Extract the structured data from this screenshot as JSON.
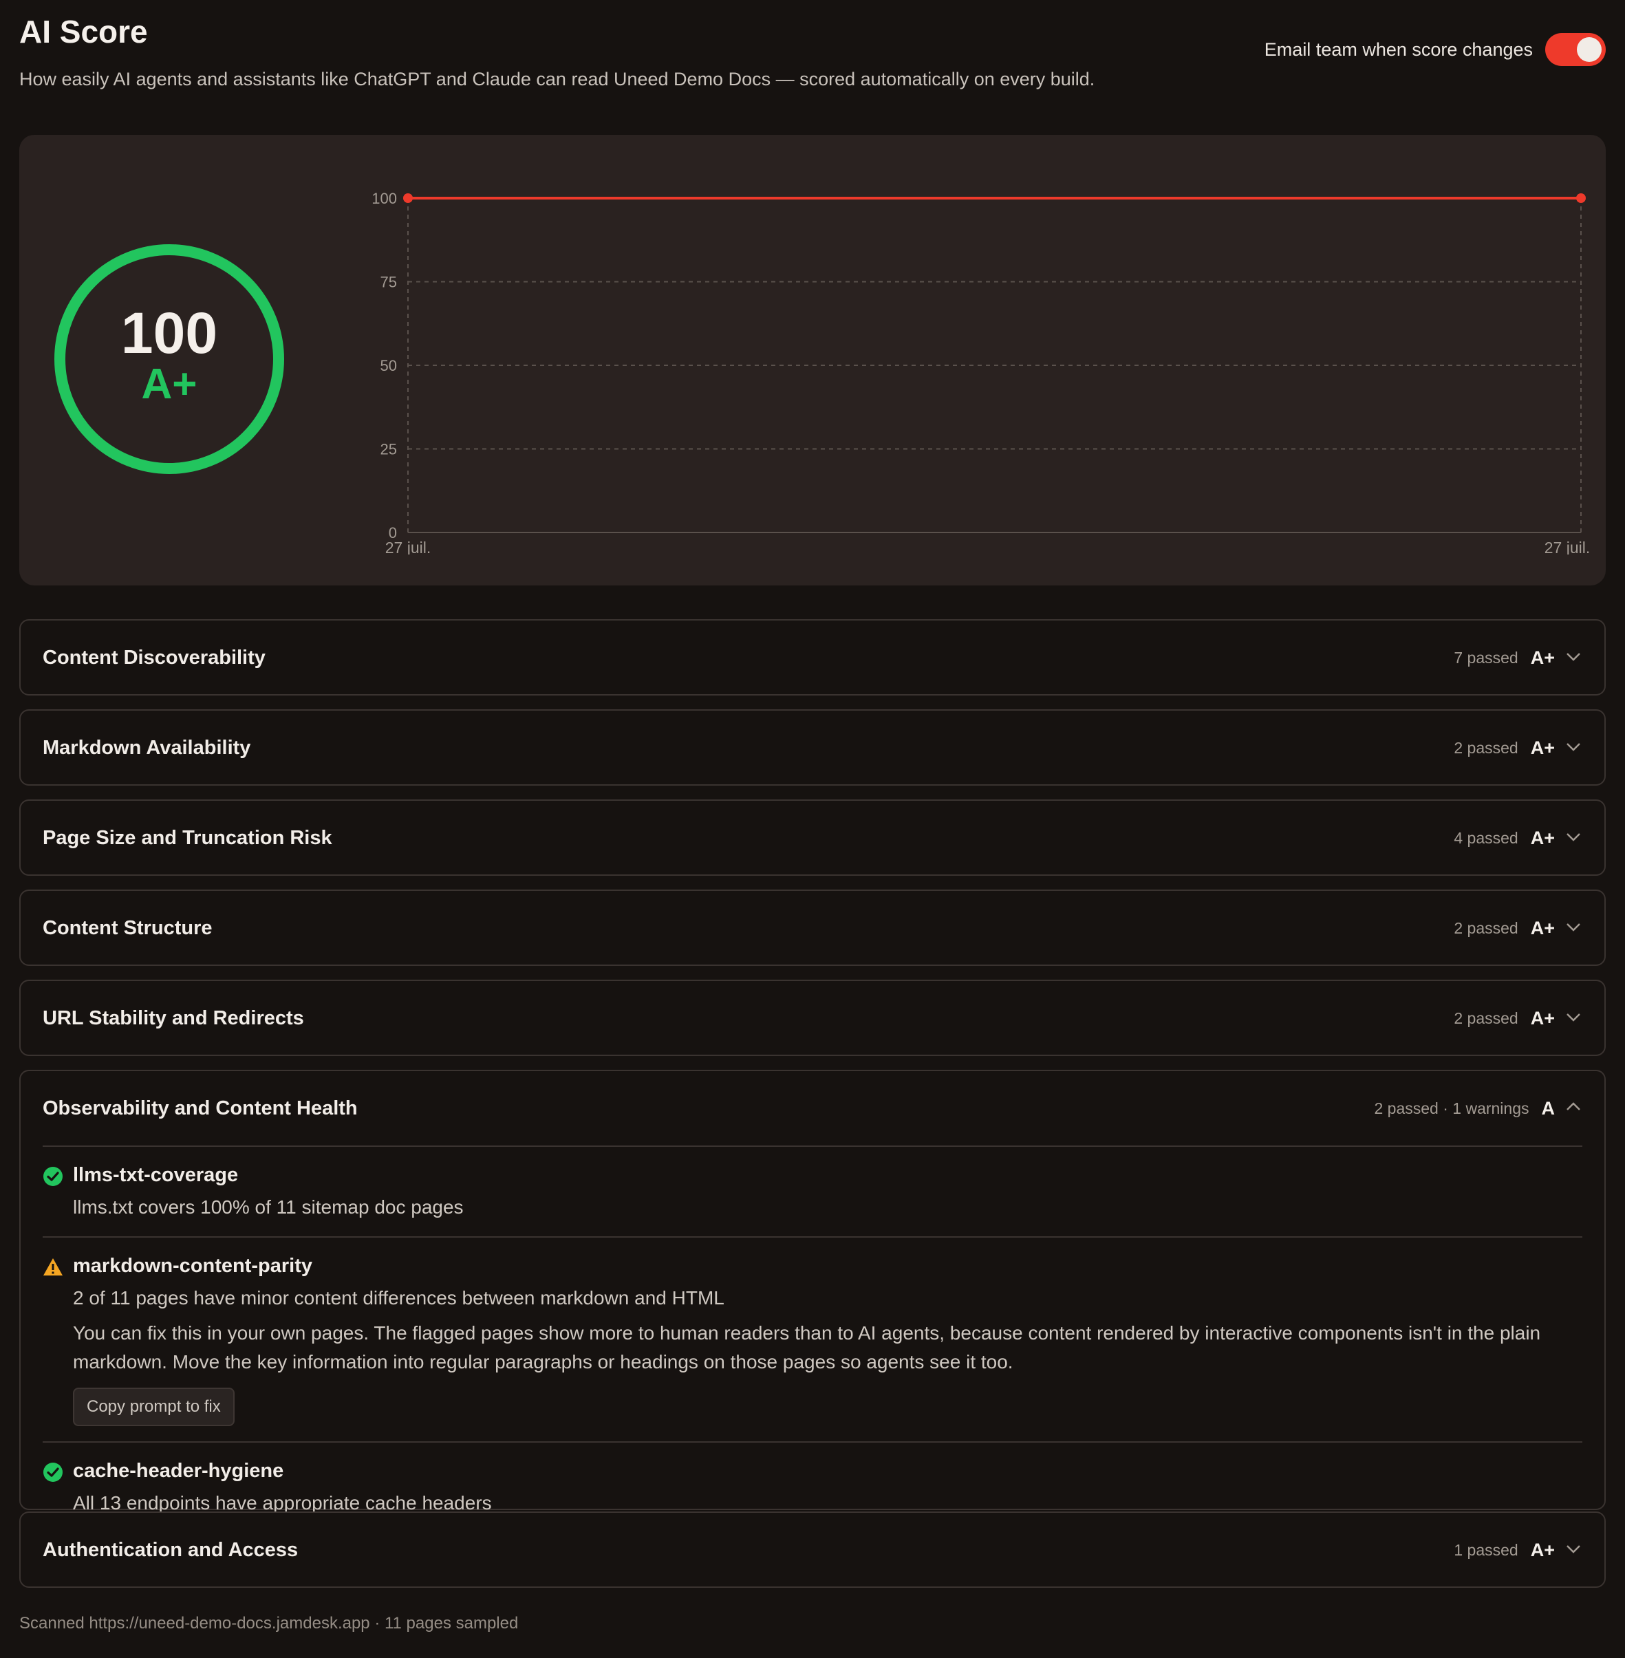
{
  "header": {
    "title": "AI Score",
    "subtitle": "How easily AI agents and assistants like ChatGPT and Claude can read Uneed Demo Docs — scored automatically on every build.",
    "email_toggle_label": "Email team when score changes",
    "email_toggle_on": true
  },
  "score": {
    "value": "100",
    "grade": "A+",
    "color": "#22c55e"
  },
  "chart_data": {
    "type": "line",
    "x": [
      "27 juil.",
      "27 juil."
    ],
    "series": [
      {
        "values": [
          100,
          100
        ],
        "color": "#ee3a2b"
      }
    ],
    "yticks": [
      "0",
      "25",
      "50",
      "75",
      "100"
    ],
    "ylim": [
      0,
      100
    ],
    "grid": true
  },
  "sections": [
    {
      "title": "Content Discoverability",
      "meta": "7 passed",
      "grade": "A+",
      "expanded": false
    },
    {
      "title": "Markdown Availability",
      "meta": "2 passed",
      "grade": "A+",
      "expanded": false
    },
    {
      "title": "Page Size and Truncation Risk",
      "meta": "4 passed",
      "grade": "A+",
      "expanded": false
    },
    {
      "title": "Content Structure",
      "meta": "2 passed",
      "grade": "A+",
      "expanded": false
    },
    {
      "title": "URL Stability and Redirects",
      "meta": "2 passed",
      "grade": "A+",
      "expanded": false
    },
    {
      "title": "Observability and Content Health",
      "meta": "2 passed · 1 warnings",
      "grade": "A",
      "expanded": true,
      "checks": [
        {
          "status": "pass",
          "name": "llms-txt-coverage",
          "desc": "llms.txt covers 100% of 11 sitemap doc pages"
        },
        {
          "status": "warn",
          "name": "markdown-content-parity",
          "desc": "2 of 11 pages have minor content differences between markdown and HTML",
          "extra": "You can fix this in your own pages. The flagged pages show more to human readers than to AI agents, because content rendered by interactive components isn't in the plain markdown. Move the key information into regular paragraphs or headings on those pages so agents see it too.",
          "button": "Copy prompt to fix"
        },
        {
          "status": "pass",
          "name": "cache-header-hygiene",
          "desc": "All 13 endpoints have appropriate cache headers"
        }
      ]
    },
    {
      "title": "Authentication and Access",
      "meta": "1 passed",
      "grade": "A+",
      "expanded": false
    }
  ],
  "footer": "Scanned https://uneed-demo-docs.jamdesk.app · 11 pages sampled",
  "colors": {
    "accent": "#ee3a2b",
    "pass": "#22c55e",
    "warn": "#f5a623"
  }
}
